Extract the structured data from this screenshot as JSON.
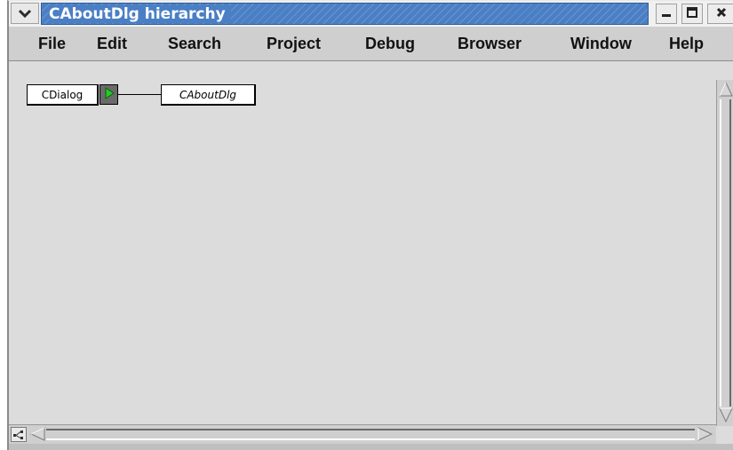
{
  "window": {
    "title": "CAboutDlg hierarchy"
  },
  "menubar": {
    "items": [
      {
        "label": "File"
      },
      {
        "label": "Edit"
      },
      {
        "label": "Search"
      },
      {
        "label": "Project"
      },
      {
        "label": "Debug"
      },
      {
        "label": "Browser"
      },
      {
        "label": "Window"
      },
      {
        "label": "Help"
      }
    ]
  },
  "hierarchy": {
    "parent_class": "CDialog",
    "child_class": "CAboutDlg"
  },
  "icons": {
    "window_menu": "chevron-down-icon",
    "minimize": "minimize-icon",
    "maximize": "maximize-icon",
    "close": "close-icon",
    "expander": "play-arrow-icon",
    "graph": "graph-icon",
    "scroll_left": "scroll-left-arrow-icon",
    "scroll_right": "scroll-right-arrow-icon",
    "scroll_up": "scroll-up-arrow-icon",
    "scroll_down": "scroll-down-arrow-icon"
  },
  "colors": {
    "titlebar": "#4a7fc5",
    "expander_arrow": "#22cc22"
  }
}
